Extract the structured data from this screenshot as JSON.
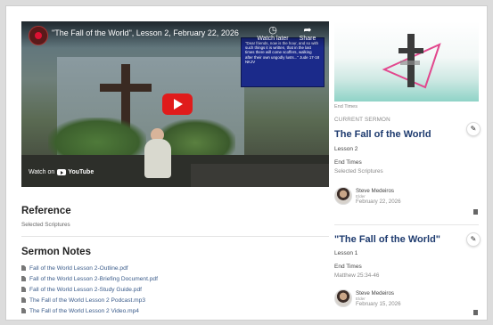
{
  "video": {
    "title": "\"The Fall of the World\", Lesson 2, February 22, 2026",
    "watch_later": "Watch later",
    "share": "Share",
    "watch_on": "Watch on",
    "youtube": "YouTube",
    "screen_text": "\"Dear friends, now is the hour, and so with such things it is written, that in the last times there will come scoffers, walking after their own ungodly lusts...\" Jude 17-18 NKJV"
  },
  "reference": {
    "heading": "Reference",
    "value": "Selected Scriptures"
  },
  "sermon_notes": {
    "heading": "Sermon Notes",
    "files": [
      "Fall of the World Lesson 2-Outline.pdf",
      "Fall of the World Lesson 2-Briefing Document.pdf",
      "Fall of the World Lesson 2-Study Guide.pdf",
      "The Fall of the World Lesson 2 Podcast.mp3",
      "The Fall of the World Lesson 2 Video.mp4"
    ]
  },
  "series": {
    "caption": "End Times"
  },
  "current": {
    "eyebrow": "CURRENT SERMON",
    "title": "The Fall of the World",
    "lesson": "Lesson 2",
    "series": "End Times",
    "scripture": "Selected Scriptures",
    "speaker": "Steve Medeiros",
    "role": "Elder",
    "date": "February 22, 2026"
  },
  "previous": {
    "title": "\"The Fall of the World\"",
    "lesson": "Lesson 1",
    "series": "End Times",
    "scripture": "Matthew 25:34-46",
    "speaker": "Steve Medeiros",
    "role": "Elder",
    "date": "February 15, 2026"
  },
  "colors": {
    "title_blue": "#1d3a6e",
    "link_blue": "#3a5b8a",
    "play_red": "#e01b1b",
    "teal": "#8fd3c7",
    "pink": "#e2478d"
  }
}
